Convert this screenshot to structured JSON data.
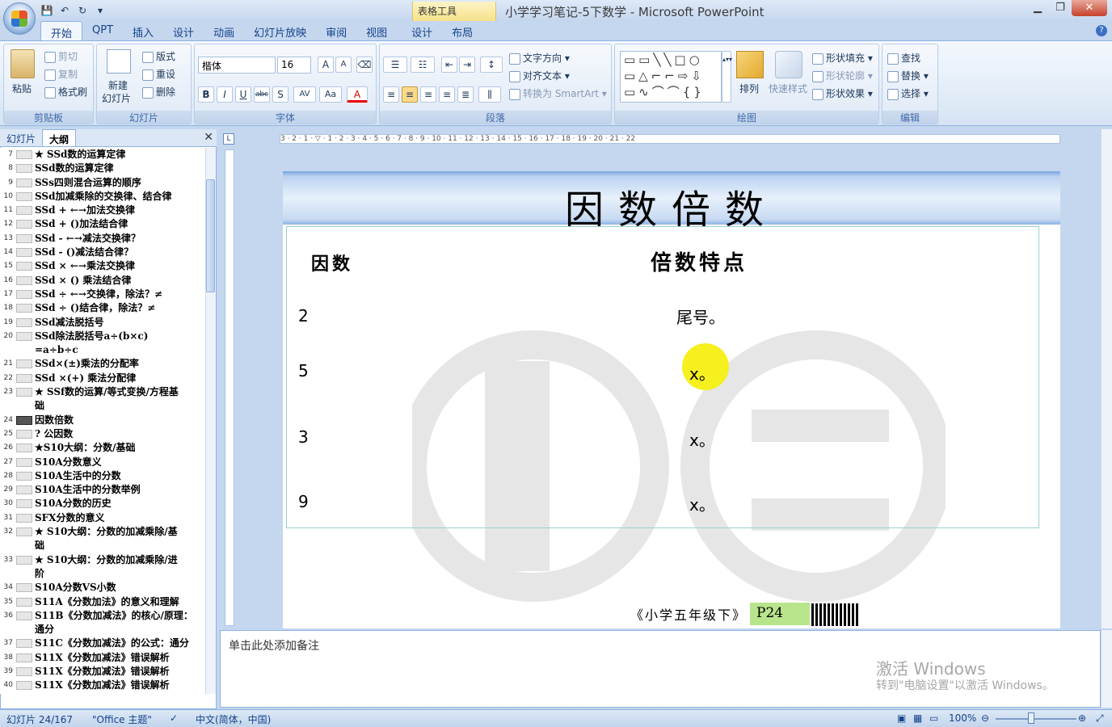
{
  "app": {
    "context_tab_group": "表格工具",
    "title": "小学学习笔记-5下数学 - Microsoft PowerPoint"
  },
  "ribbon_tabs": [
    "开始",
    "QPT",
    "插入",
    "设计",
    "动画",
    "幻灯片放映",
    "审阅",
    "视图",
    "设计",
    "布局"
  ],
  "clipboard": {
    "paste": "粘贴",
    "cut": "剪切",
    "copy": "复制",
    "format_painter": "格式刷",
    "label": "剪贴板"
  },
  "slides_group": {
    "new_slide": "新建",
    "new_slide2": "幻灯片",
    "layout": "版式",
    "reset": "重设",
    "delete": "删除",
    "label": "幻灯片"
  },
  "font_group": {
    "font": "楷体",
    "size": "16",
    "label": "字体",
    "bold": "B",
    "italic": "I",
    "underline": "U",
    "strike": "abc",
    "shadow": "S",
    "spacing": "AV",
    "case": "Aa",
    "color": "A",
    "grow": "A",
    "shrink": "A"
  },
  "paragraph_group": {
    "text_direction": "文字方向",
    "align_text": "对齐文本",
    "smartart": "转换为 SmartArt",
    "label": "段落"
  },
  "drawing_group": {
    "arrange": "排列",
    "quick_styles": "快速样式",
    "shape_fill": "形状填充",
    "shape_outline": "形状轮廓",
    "shape_effects": "形状效果",
    "label": "绘图"
  },
  "editing_group": {
    "find": "查找",
    "replace": "替换",
    "select": "选择",
    "label": "编辑"
  },
  "panel_tabs": {
    "slides": "幻灯片",
    "outline": "大纲"
  },
  "outline": [
    {
      "n": "7",
      "t": "★ SSd数的运算定律",
      "sel": false
    },
    {
      "n": "8",
      "t": "  SSd数的运算定律",
      "sel": false
    },
    {
      "n": "9",
      "t": "SSs四则混合运算的顺序",
      "sel": false
    },
    {
      "n": "10",
      "t": "SSd加减乘除的交换律、结合律",
      "sel": false
    },
    {
      "n": "11",
      "t": "SSd + ←→加法交换律",
      "sel": false
    },
    {
      "n": "12",
      "t": "SSd + ()加法结合律",
      "sel": false
    },
    {
      "n": "13",
      "t": "SSd - ←→减法交换律？",
      "sel": false
    },
    {
      "n": "14",
      "t": "SSd - ()减法结合律？",
      "sel": false
    },
    {
      "n": "15",
      "t": "SSd × ←→乘法交换律",
      "sel": false
    },
    {
      "n": "16",
      "t": "SSd × () 乘法结合律",
      "sel": false
    },
    {
      "n": "17",
      "t": "SSd ÷ ←→交换律，除法？≠",
      "sel": false
    },
    {
      "n": "18",
      "t": "SSd ÷ ()结合律，除法？≠",
      "sel": false
    },
    {
      "n": "19",
      "t": "SSd减法脱括号",
      "sel": false
    },
    {
      "n": "20",
      "t": "SSd除法脱括号a÷(b×c)",
      "sel": false
    },
    {
      "n": "",
      "t": "=a÷b÷c",
      "sel": false
    },
    {
      "n": "21",
      "t": "SSd×(±)乘法的分配率",
      "sel": false
    },
    {
      "n": "22",
      "t": "SSd ×(+) 乘法分配律",
      "sel": false
    },
    {
      "n": "23",
      "t": "★ SSf数的运算/等式变换/方程基",
      "sel": false
    },
    {
      "n": "",
      "t": "础",
      "sel": false
    },
    {
      "n": "24",
      "t": "因数倍数",
      "sel": true
    },
    {
      "n": "25",
      "t": "? 公因数",
      "sel": false
    },
    {
      "n": "26",
      "t": "★S10大纲：分数/基础",
      "sel": false
    },
    {
      "n": "27",
      "t": "S10A分数意义",
      "sel": false
    },
    {
      "n": "28",
      "t": "S10A生活中的分数",
      "sel": false
    },
    {
      "n": "29",
      "t": "S10A生活中的分数举例",
      "sel": false
    },
    {
      "n": "30",
      "t": "S10A分数的历史",
      "sel": false
    },
    {
      "n": "31",
      "t": "SFX分数的意义",
      "sel": false
    },
    {
      "n": "32",
      "t": "★ S10大纲：分数的加减乘除/基",
      "sel": false
    },
    {
      "n": "",
      "t": "础",
      "sel": false
    },
    {
      "n": "33",
      "t": "★ S10大纲：分数的加减乘除/进",
      "sel": false
    },
    {
      "n": "",
      "t": "阶",
      "sel": false
    },
    {
      "n": "34",
      "t": "S10A分数VS小数",
      "sel": false
    },
    {
      "n": "35",
      "t": "S11A《分数加法》的意义和理解",
      "sel": false
    },
    {
      "n": "36",
      "t": "S11B《分数加减法》的核心/原理：",
      "sel": false
    },
    {
      "n": "",
      "t": "通分",
      "sel": false
    },
    {
      "n": "37",
      "t": "S11C《分数加减法》的公式：通分",
      "sel": false
    },
    {
      "n": "38",
      "t": "S11X《分数加减法》错误解析",
      "sel": false
    },
    {
      "n": "39",
      "t": "S11X《分数加减法》错误解析",
      "sel": false
    },
    {
      "n": "40",
      "t": "S11X《分数加减法》错误解析",
      "sel": false
    }
  ],
  "slide": {
    "title": "因数倍数",
    "col1_header": "因数",
    "col2_header": "倍数特点",
    "rows": [
      {
        "factor": "2",
        "feature": "尾号。"
      },
      {
        "factor": "5",
        "feature": "x。"
      },
      {
        "factor": "3",
        "feature": "x。"
      },
      {
        "factor": "9",
        "feature": "x。"
      }
    ],
    "footer": "《小学五年级下》",
    "page": "P24"
  },
  "ruler_labels": "3 · 2 · 1 · ▽ · 1 · 2 · 3 · 4 · 5 · 6 · 7 · 8 · 9 · 10 · 11 · 12 · 13 · 14 · 15 · 16 · 17 · 18 · 19 · 20 · 21 · 22",
  "notes": {
    "placeholder": "单击此处添加备注",
    "activate_line1": "激活 Windows",
    "activate_line2": "转到\"电脑设置\"以激活 Windows。"
  },
  "status": {
    "slide": "幻灯片 24/167",
    "theme": "\"Office 主题\"",
    "language": "中文(简体，中国)",
    "zoom": "100%"
  }
}
